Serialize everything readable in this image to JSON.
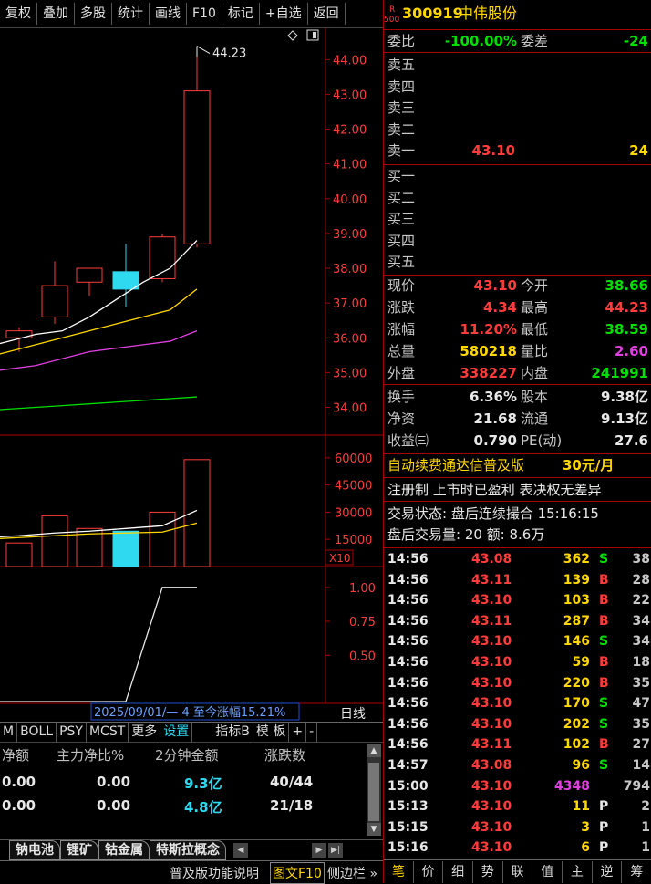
{
  "toolbar": {
    "buttons": [
      "复权",
      "叠加",
      "多股",
      "统计",
      "画线",
      "F10",
      "标记",
      "+自选",
      "返回"
    ]
  },
  "stock": {
    "market_tag_top": "R",
    "market_tag_bottom": "500",
    "code": "300919",
    "name": "中伟股份"
  },
  "weibi": {
    "label": "委比",
    "value": "-100.00%",
    "label2": "委差",
    "value2": "-24"
  },
  "sell": [
    {
      "label": "卖五",
      "price": "",
      "vol": ""
    },
    {
      "label": "卖四",
      "price": "",
      "vol": ""
    },
    {
      "label": "卖三",
      "price": "",
      "vol": ""
    },
    {
      "label": "卖二",
      "price": "",
      "vol": ""
    },
    {
      "label": "卖一",
      "price": "43.10",
      "vol": "24"
    }
  ],
  "buy": [
    {
      "label": "买一"
    },
    {
      "label": "买二"
    },
    {
      "label": "买三"
    },
    {
      "label": "买四"
    },
    {
      "label": "买五"
    }
  ],
  "quote": [
    {
      "l1": "现价",
      "v1": "43.10",
      "c1": "#ff3c3c",
      "l2": "今开",
      "v2": "38.66",
      "c2": "#00e000"
    },
    {
      "l1": "涨跌",
      "v1": "4.34",
      "c1": "#ff3c3c",
      "l2": "最高",
      "v2": "44.23",
      "c2": "#ff3c3c"
    },
    {
      "l1": "涨幅",
      "v1": "11.20%",
      "c1": "#ff3c3c",
      "l2": "最低",
      "v2": "38.59",
      "c2": "#00e000"
    },
    {
      "l1": "总量",
      "v1": "580218",
      "c1": "#ffd800",
      "l2": "量比",
      "v2": "2.60",
      "c2": "#e040e0"
    },
    {
      "l1": "外盘",
      "v1": "338227",
      "c1": "#ff3c3c",
      "l2": "内盘",
      "v2": "241991",
      "c2": "#00e000"
    }
  ],
  "fund": [
    {
      "l1": "换手",
      "v1": "6.36%",
      "l2": "股本",
      "v2": "9.38亿"
    },
    {
      "l1": "净资",
      "v1": "21.68",
      "l2": "流通",
      "v2": "9.13亿"
    },
    {
      "l1": "收益㈢",
      "v1": "0.790",
      "l2": "PE(动)",
      "v2": "27.6"
    }
  ],
  "ad": {
    "text": "自动续费通达信普及版",
    "price": "30元/月"
  },
  "notice": "注册制 上市时已盈利 表决权无差异",
  "status": {
    "line1": "交易状态: 盘后连续撮合 15:16:15",
    "line2": "盘后交易量: 20 额: 8.6万"
  },
  "ticks": [
    {
      "t": "14:56",
      "p": "43.08",
      "v": "362",
      "vc": "#ffd800",
      "d": "S",
      "n": "38"
    },
    {
      "t": "14:56",
      "p": "43.11",
      "v": "139",
      "vc": "#ffd800",
      "d": "B",
      "n": "28"
    },
    {
      "t": "14:56",
      "p": "43.10",
      "v": "103",
      "vc": "#ffd800",
      "d": "B",
      "n": "22"
    },
    {
      "t": "14:56",
      "p": "43.11",
      "v": "287",
      "vc": "#ffd800",
      "d": "B",
      "n": "34"
    },
    {
      "t": "14:56",
      "p": "43.10",
      "v": "146",
      "vc": "#ffd800",
      "d": "S",
      "n": "34"
    },
    {
      "t": "14:56",
      "p": "43.10",
      "v": "59",
      "vc": "#ffd800",
      "d": "B",
      "n": "18"
    },
    {
      "t": "14:56",
      "p": "43.10",
      "v": "220",
      "vc": "#ffd800",
      "d": "B",
      "n": "35"
    },
    {
      "t": "14:56",
      "p": "43.10",
      "v": "170",
      "vc": "#ffd800",
      "d": "S",
      "n": "47"
    },
    {
      "t": "14:56",
      "p": "43.10",
      "v": "202",
      "vc": "#ffd800",
      "d": "S",
      "n": "35"
    },
    {
      "t": "14:56",
      "p": "43.11",
      "v": "102",
      "vc": "#ffd800",
      "d": "B",
      "n": "27"
    },
    {
      "t": "14:57",
      "p": "43.08",
      "v": "96",
      "vc": "#ffd800",
      "d": "S",
      "n": "14"
    },
    {
      "t": "15:00",
      "p": "43.10",
      "v": "4348",
      "vc": "#e040e0",
      "d": "",
      "n": "794"
    },
    {
      "t": "15:13",
      "p": "43.10",
      "v": "11",
      "vc": "#ffd800",
      "d": "P",
      "n": "2"
    },
    {
      "t": "15:15",
      "p": "43.10",
      "v": "3",
      "vc": "#ffd800",
      "d": "P",
      "n": "1"
    },
    {
      "t": "15:16",
      "p": "43.10",
      "v": "6",
      "vc": "#ffd800",
      "d": "P",
      "n": "1"
    }
  ],
  "right_tabs": [
    "笔",
    "价",
    "细",
    "势",
    "联",
    "值",
    "主",
    "逆",
    "筹"
  ],
  "kline": {
    "price_ticks": [
      "44.00",
      "43.00",
      "42.00",
      "41.00",
      "40.00",
      "39.00",
      "38.00",
      "37.00",
      "36.00",
      "35.00",
      "34.00"
    ],
    "high_label": "44.23",
    "vol_ticks": [
      "60000",
      "45000",
      "30000",
      "15000"
    ],
    "vol_unit": "X10",
    "ind_ticks": [
      "1.00",
      "0.75",
      "0.50"
    ],
    "range_info": "2025/09/01/— 4 至今涨幅15.21%",
    "period": "日线"
  },
  "chart_data": [
    {
      "type": "candlestick",
      "title": "",
      "ylim": [
        33.2,
        44.9
      ],
      "candles": [
        {
          "open": 36.2,
          "close": 35.6,
          "high": 36.2,
          "low": 35.2,
          "color": "#ff3c3c",
          "hollow": true
        },
        {
          "open": 36.0,
          "close": 36.2,
          "high": 36.3,
          "low": 35.6,
          "color": "#ff3c3c",
          "hollow": true
        },
        {
          "open": 36.6,
          "close": 37.5,
          "high": 38.2,
          "low": 36.4,
          "color": "#ff3c3c",
          "hollow": true
        },
        {
          "open": 37.6,
          "close": 38.0,
          "high": 38.0,
          "low": 37.2,
          "color": "#ff3c3c",
          "hollow": true
        },
        {
          "open": 37.9,
          "close": 37.4,
          "high": 38.7,
          "low": 36.9,
          "color": "#2fd9f0",
          "hollow": false
        },
        {
          "open": 37.7,
          "close": 38.9,
          "high": 39.0,
          "low": 37.6,
          "color": "#ff3c3c",
          "hollow": true
        },
        {
          "open": 38.7,
          "close": 43.1,
          "high": 44.23,
          "low": 38.6,
          "color": "#ff3c3c",
          "hollow": true
        }
      ],
      "ma": [
        {
          "color": "#ffffff",
          "values": [
            35.7,
            35.9,
            36.1,
            36.2,
            36.6,
            37.1,
            37.6,
            38.0,
            38.8
          ]
        },
        {
          "color": "#ffd800",
          "values": [
            35.4,
            35.6,
            35.8,
            36.0,
            36.2,
            36.4,
            36.6,
            36.8,
            37.4
          ]
        },
        {
          "color": "#e040e0",
          "values": [
            35.0,
            35.1,
            35.2,
            35.4,
            35.6,
            35.7,
            35.8,
            35.9,
            36.2
          ]
        },
        {
          "color": "#00e000",
          "values": [
            33.9,
            33.95,
            34.0,
            34.05,
            34.1,
            34.15,
            34.2,
            34.25,
            34.3
          ]
        }
      ]
    },
    {
      "type": "bar",
      "title": "",
      "ylim": [
        0,
        72000
      ],
      "values": [
        12000,
        13000,
        28000,
        21000,
        19500,
        30000,
        59000
      ],
      "colors": [
        "#ff3c3c",
        "#ff3c3c",
        "#ff3c3c",
        "#ff3c3c",
        "#2fd9f0",
        "#ff3c3c",
        "#ff3c3c"
      ],
      "ma": [
        {
          "color": "#ffffff",
          "values": [
            16000,
            17000,
            18500,
            19500,
            21000,
            22500,
            31000
          ]
        },
        {
          "color": "#ffd800",
          "values": [
            15000,
            16000,
            17000,
            18000,
            18500,
            19000,
            24000
          ]
        }
      ]
    },
    {
      "type": "line",
      "title": "",
      "ylim": [
        0.2,
        1.2
      ],
      "x": [
        0,
        1,
        2,
        3,
        4,
        5,
        6,
        7,
        8
      ],
      "values": [
        0.0,
        0.0,
        0.0,
        0.0,
        0.0,
        0.0,
        0.0,
        1.0,
        1.0
      ]
    }
  ],
  "bottom_tabs": [
    "M",
    "BOLL",
    "PSY",
    "MCST",
    "更多",
    "设置",
    "指标B",
    "模 板",
    "+",
    "-"
  ],
  "flow": {
    "headers": [
      "净额",
      "主力净比%",
      "2分钟金额",
      "涨跌数"
    ],
    "rows": [
      {
        "a": "0.00",
        "b": "0.00",
        "c": "9.3亿",
        "d": "40/44"
      },
      {
        "a": "0.00",
        "b": "0.00",
        "c": "4.8亿",
        "d": "21/18"
      }
    ]
  },
  "sector_tabs": [
    "钠电池",
    "锂矿",
    "钴金属",
    "特斯拉概念"
  ],
  "footer": {
    "left": "普及版功能说明",
    "mid": "图文F10",
    "right": "侧边栏 »"
  }
}
